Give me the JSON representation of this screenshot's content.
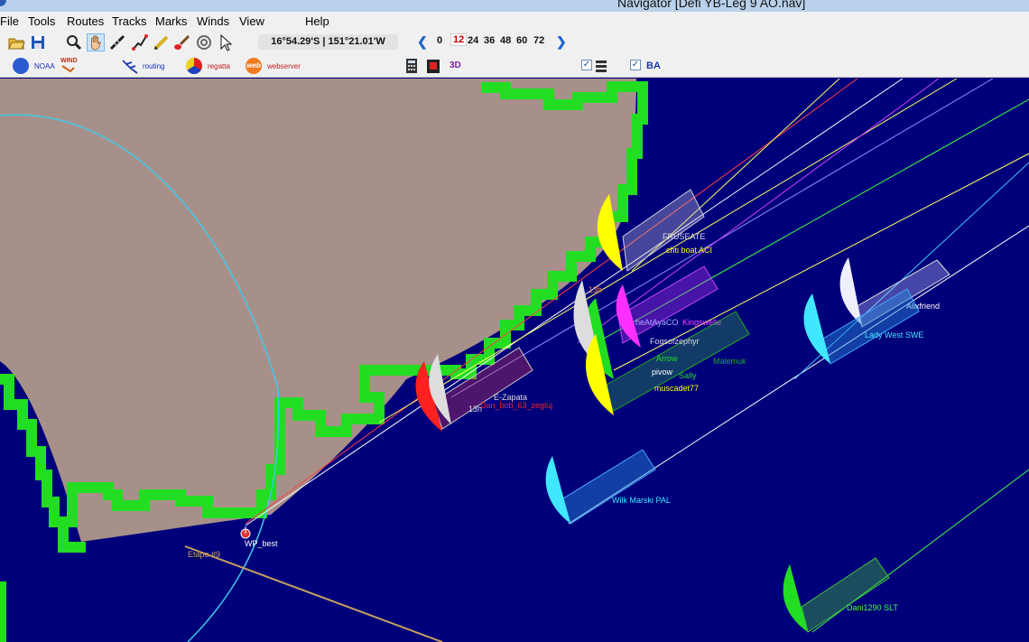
{
  "window": {
    "title": "Navigator [Defi YB-Leg 9 AO.nav]"
  },
  "menu": [
    "File",
    "Tools",
    "Routes",
    "Tracks",
    "Marks",
    "Winds",
    "View",
    "Help"
  ],
  "toolbar": {
    "coordinates": "16°54.29'S | 151°21.01'W",
    "hours": [
      "0",
      "12",
      "24",
      "36",
      "48",
      "60",
      "72"
    ],
    "selected_hour": "12",
    "icons": [
      "open-folder-icon",
      "save-icon",
      "zoom-icon",
      "pan-hand-icon",
      "ruler-icon",
      "route-icon",
      "pencil-icon",
      "brush-icon",
      "target-icon",
      "pointer-icon"
    ]
  },
  "toolbar2": {
    "noaa": "NOAA",
    "wind": "WIND",
    "routing": "routing",
    "regatta": "regatta",
    "web_badge": "web",
    "webserver": "webserver",
    "three_d": "3D",
    "ba": "BA"
  },
  "map": {
    "colors": {
      "sea": "#00007a",
      "land": "#a8908a",
      "coast": "#22dd22",
      "circle": "#40c8e8"
    },
    "waypoint": "WP_best",
    "leg_label": "Etape #9",
    "time_marks": [
      "13h",
      "13h"
    ],
    "boats": [
      {
        "name": "FRUSEATE",
        "color": "#dddddd"
      },
      {
        "name": "chti boat ACI",
        "color": "#ffff00"
      },
      {
        "name": "heAtAyaCO",
        "color": "#aaaaff"
      },
      {
        "name": "Kingswelle",
        "color": "#ff33ff"
      },
      {
        "name": "Fogsofzephyr",
        "color": "#dddddd"
      },
      {
        "name": "Malemuk",
        "color": "#22aa22"
      },
      {
        "name": "Arrow",
        "color": "#22dd22"
      },
      {
        "name": "pivow",
        "color": "#ffffff"
      },
      {
        "name": "Sally",
        "color": "#22dd22"
      },
      {
        "name": "muscadet77",
        "color": "#ffff00"
      },
      {
        "name": "E-Zapata",
        "color": "#dddddd"
      },
      {
        "name": "Dan_bob_63_zegluj",
        "color": "#ff2020"
      },
      {
        "name": "Alixfriend",
        "color": "#ffffff"
      },
      {
        "name": "Lady West SWE",
        "color": "#40e8ff"
      },
      {
        "name": "Wilk Marski PAL",
        "color": "#40e8ff"
      },
      {
        "name": "Dani1290 SLT",
        "color": "#22dd22"
      }
    ]
  }
}
